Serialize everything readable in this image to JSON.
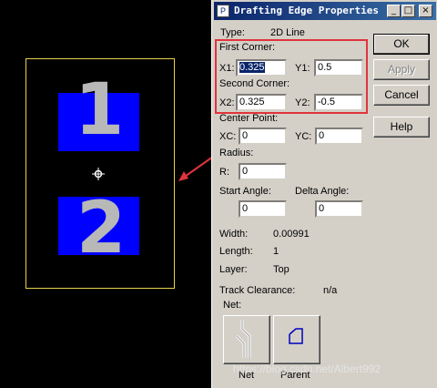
{
  "dialog": {
    "title": "Drafting Edge Properties",
    "type_label": "Type:",
    "type_value": "2D Line",
    "first_corner_label": "First Corner:",
    "x1_label": "X1:",
    "x1_value": "0.325",
    "y1_label": "Y1:",
    "y1_value": "0.5",
    "second_corner_label": "Second Corner:",
    "x2_label": "X2:",
    "x2_value": "0.325",
    "y2_label": "Y2:",
    "y2_value": "-0.5",
    "center_point_label": "Center Point:",
    "xc_label": "XC:",
    "xc_value": "0",
    "yc_label": "YC:",
    "yc_value": "0",
    "radius_label": "Radius:",
    "r_label": "R:",
    "r_value": "0",
    "start_angle_label": "Start Angle:",
    "start_angle_value": "0",
    "delta_angle_label": "Delta Angle:",
    "delta_angle_value": "0",
    "width_label": "Width:",
    "width_value": "0.00991",
    "length_label": "Length:",
    "length_value": "1",
    "layer_label": "Layer:",
    "layer_value": "Top",
    "track_clearance_label": "Track Clearance:",
    "track_clearance_value": "n/a",
    "net_label": "Net:",
    "net_button_label": "Net",
    "parent_button_label": "Parent",
    "buttons": {
      "ok": "OK",
      "apply": "Apply",
      "cancel": "Cancel",
      "help": "Help"
    },
    "title_buttons": {
      "minimize": "_",
      "maximize": "□",
      "close": "×"
    }
  },
  "canvas": {
    "pad1_number": "1",
    "pad2_number": "2"
  },
  "watermark": "https://blog.csdn.net/Albert992",
  "colors": {
    "canvas_bg": "#000000",
    "pad": "#0000ff",
    "outline": "#e6d24a",
    "highlight": "#e0343c",
    "titlebar": "#0a246a"
  }
}
